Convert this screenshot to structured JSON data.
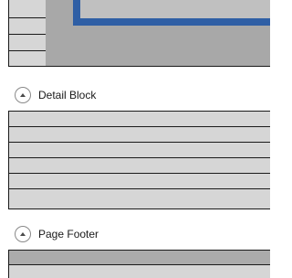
{
  "sections": {
    "detail": {
      "title": "Detail Block"
    },
    "footer": {
      "title": "Page Footer"
    }
  },
  "colors": {
    "canvas": "#a8a8a8",
    "selection": "#2f5fa5",
    "band": "#d6d6d6"
  }
}
